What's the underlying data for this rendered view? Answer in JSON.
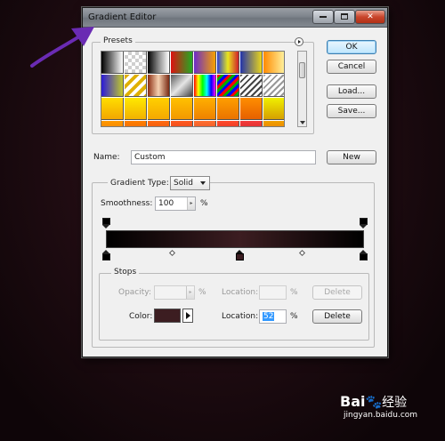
{
  "window": {
    "title": "Gradient Editor"
  },
  "presets": {
    "label": "Presets",
    "swatches": [
      "linear-gradient(90deg,#000,#fff)",
      "repeating-conic-gradient(#cfcfcf 0 25%,#fff 0 50%) 0 0/8px 8px",
      "linear-gradient(90deg,#000,#888,#fff)",
      "linear-gradient(90deg,#d11,#2a2)",
      "linear-gradient(90deg,#6b2cc9,#f6a100)",
      "linear-gradient(90deg,#2a3fd1,#e8e61d,#d0202a)",
      "linear-gradient(90deg,#2233aa,#e8d51c)",
      "linear-gradient(90deg,#ff8a00,#fff3a0)",
      "linear-gradient(90deg,#2a1ad9,#c1c92a)",
      "repeating-linear-gradient(135deg,#e0b000 0 4px,#fff 4px 8px)",
      "linear-gradient(90deg,#8b2d12,#f5d1b0,#7a2a14)",
      "linear-gradient(135deg,#5a5a5a,#e6e6e6,#444)",
      "linear-gradient(90deg,#f00,#ff0,#0f0,#0ff,#00f,#f0f)",
      "repeating-linear-gradient(135deg,#f00 0 3px,#0a0 3px 6px,#00f 6px 9px)",
      "repeating-linear-gradient(135deg,#444 0 2px,#fff 2px 5px)",
      "repeating-linear-gradient(135deg,#999 0 2px,#fff 2px 5px)",
      "linear-gradient(180deg,#ffde00,#f3a600)",
      "linear-gradient(180deg,#ffe900,#f2b100)",
      "linear-gradient(180deg,#ffd000,#f5a800)",
      "linear-gradient(180deg,#ffc100,#f39800)",
      "linear-gradient(180deg,#ffb000,#ef8100)",
      "linear-gradient(180deg,#ff9f00,#ea7300)",
      "linear-gradient(180deg,#ff8e00,#e66000)",
      "linear-gradient(180deg,#f0f000,#d6a000)",
      "linear-gradient(180deg,#ff9900,#ec6a00)",
      "linear-gradient(180deg,#ff7f00,#e0500a)",
      "linear-gradient(180deg,#ff6a10,#d8400c)",
      "linear-gradient(180deg,#ff5a20,#cc2f14)",
      "linear-gradient(180deg,#ff6f30,#d1361c)",
      "linear-gradient(180deg,#ff4a2c,#c51f16)",
      "linear-gradient(180deg,#f33b3b,#b91a1a)",
      "linear-gradient(180deg,#f0a000,#e05a00)"
    ]
  },
  "buttons": {
    "ok": "OK",
    "cancel": "Cancel",
    "load": "Load...",
    "save": "Save...",
    "new": "New"
  },
  "name": {
    "label": "Name:",
    "value": "Custom"
  },
  "gradient_type": {
    "label": "Gradient Type:",
    "value": "Solid"
  },
  "smoothness": {
    "label": "Smoothness:",
    "value": "100",
    "unit": "%"
  },
  "gradient": {
    "color_stops": [
      {
        "color": "#000000",
        "location": 0
      },
      {
        "color": "#3c1d21",
        "location": 52
      },
      {
        "color": "#000000",
        "location": 100
      }
    ],
    "opacity_stops": [
      {
        "opacity": 100,
        "location": 0
      },
      {
        "opacity": 100,
        "location": 100
      }
    ]
  },
  "stops": {
    "label": "Stops",
    "opacity_label": "Opacity:",
    "opacity_value": "",
    "location_label": "Location:",
    "unit": "%",
    "delete_label": "Delete",
    "color_label": "Color:",
    "color_value": "#3c1d21",
    "color_location_value": "52"
  },
  "watermark": {
    "logo": "Bai",
    "logo2": "经验",
    "url": "jingyan.baidu.com"
  },
  "colors": {
    "background": "#200c12",
    "accent": "#3c7fb1",
    "selection": "#3399ff"
  }
}
